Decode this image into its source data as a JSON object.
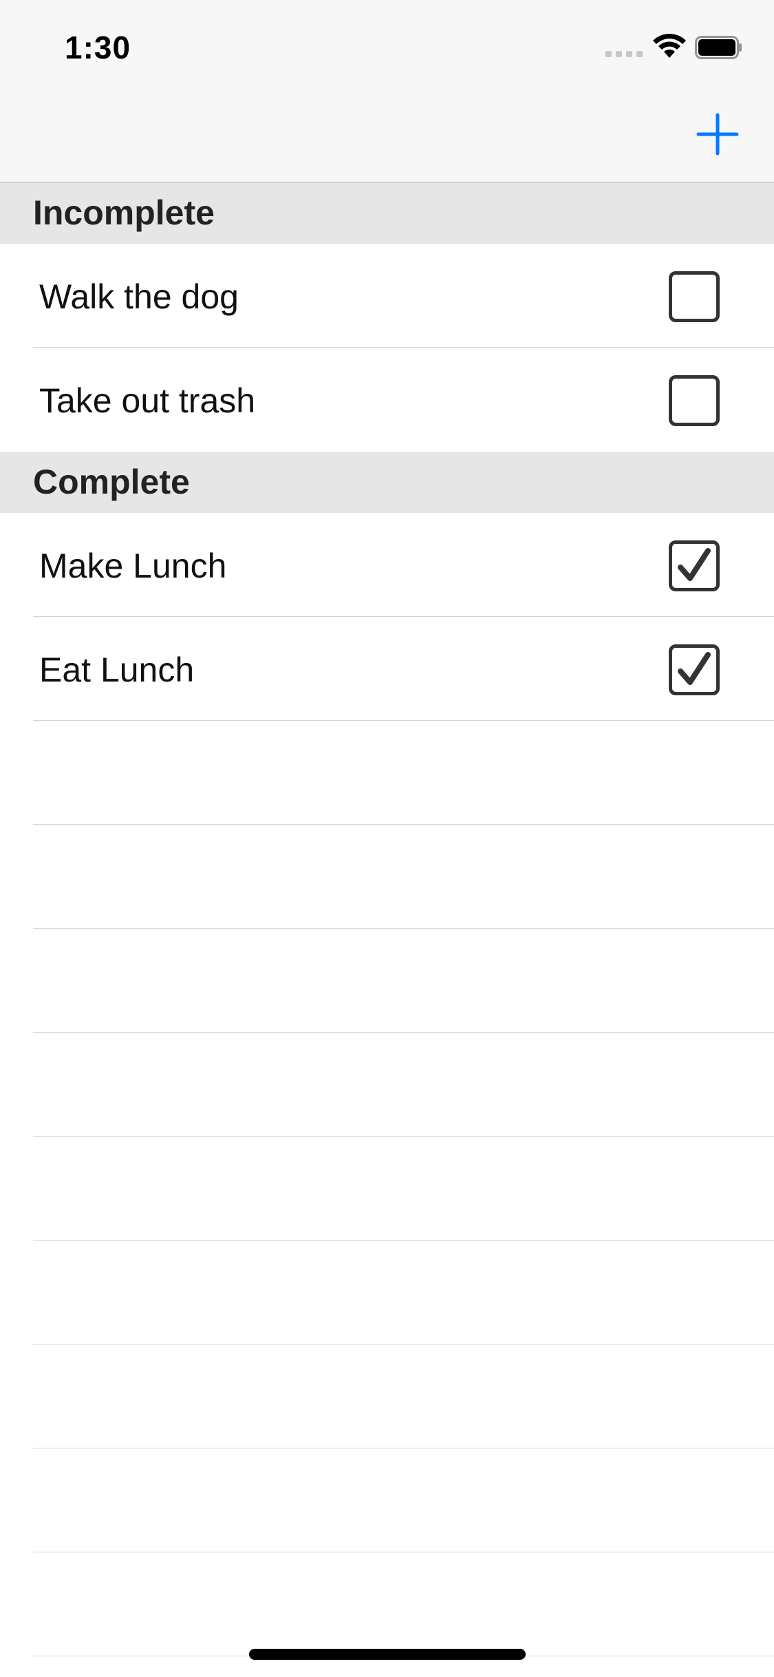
{
  "status_bar": {
    "time": "1:30"
  },
  "nav": {
    "add_icon": "plus-icon",
    "accent_color": "#007aff"
  },
  "sections": [
    {
      "title": "Incomplete",
      "items": [
        {
          "label": "Walk the dog",
          "checked": false
        },
        {
          "label": "Take out trash",
          "checked": false
        }
      ]
    },
    {
      "title": "Complete",
      "items": [
        {
          "label": "Make Lunch",
          "checked": true
        },
        {
          "label": "Eat Lunch",
          "checked": true
        }
      ]
    }
  ]
}
